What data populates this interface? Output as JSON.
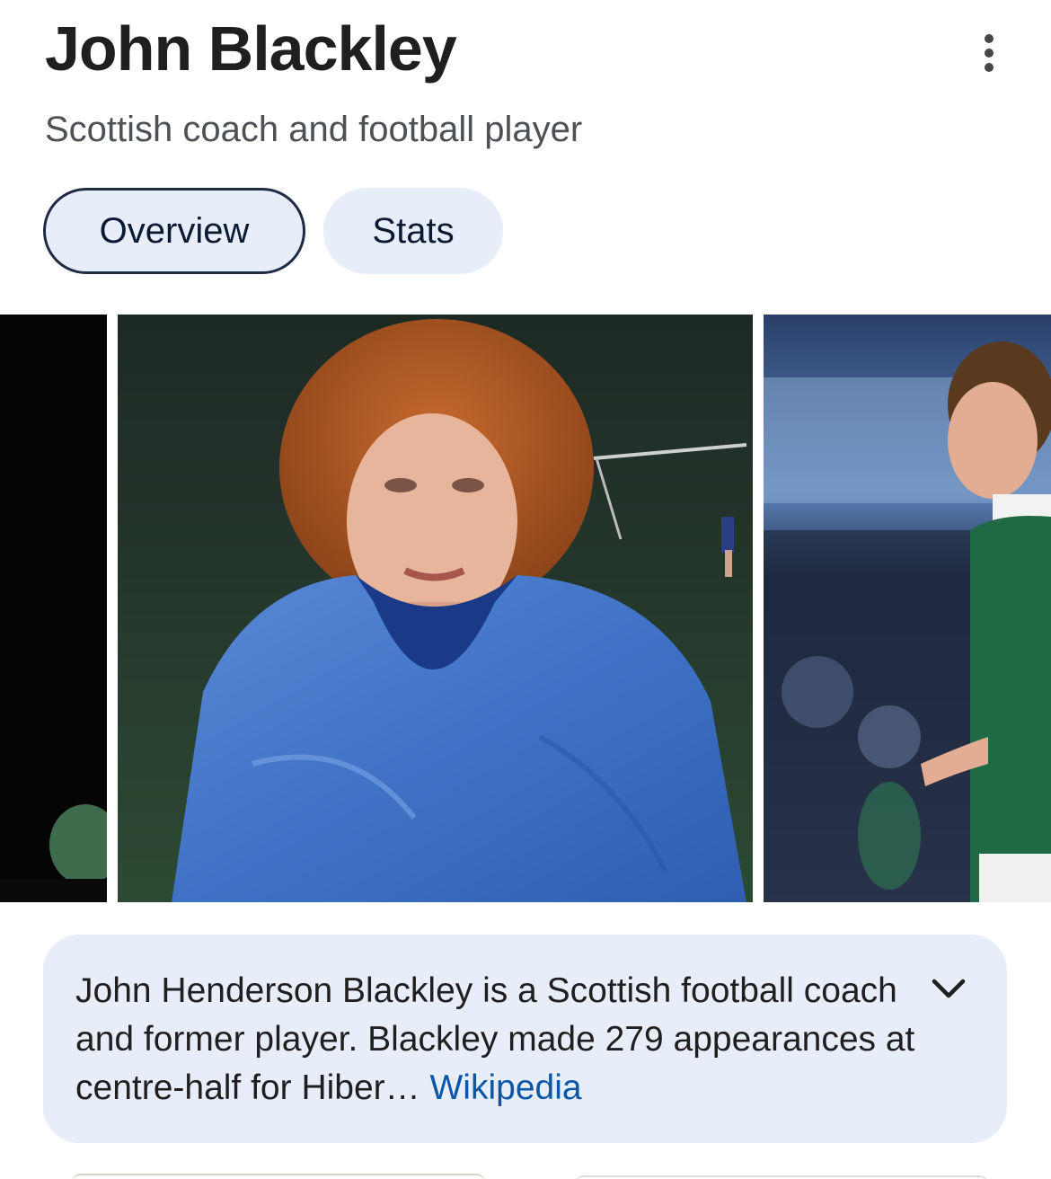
{
  "header": {
    "title": "John Blackley",
    "subtitle": "Scottish coach and football player",
    "more_icon": "more-vert-icon"
  },
  "tabs": [
    {
      "label": "Overview",
      "selected": true
    },
    {
      "label": "Stats",
      "selected": false
    }
  ],
  "images": [
    {
      "name": "image-partial-left"
    },
    {
      "name": "image-blue-tracksuit"
    },
    {
      "name": "image-green-kit"
    }
  ],
  "description": {
    "text": "John Henderson Blackley is a Scottish football coach and former player. Blackley made 279 appearances at centre-half for Hiber",
    "ellipsis": "…",
    "source_link": "Wikipedia",
    "expand_icon": "chevron-down-icon"
  },
  "colors": {
    "tab_bg": "#e8eef9",
    "link": "#0b57a7",
    "title": "#1f1f1f"
  }
}
